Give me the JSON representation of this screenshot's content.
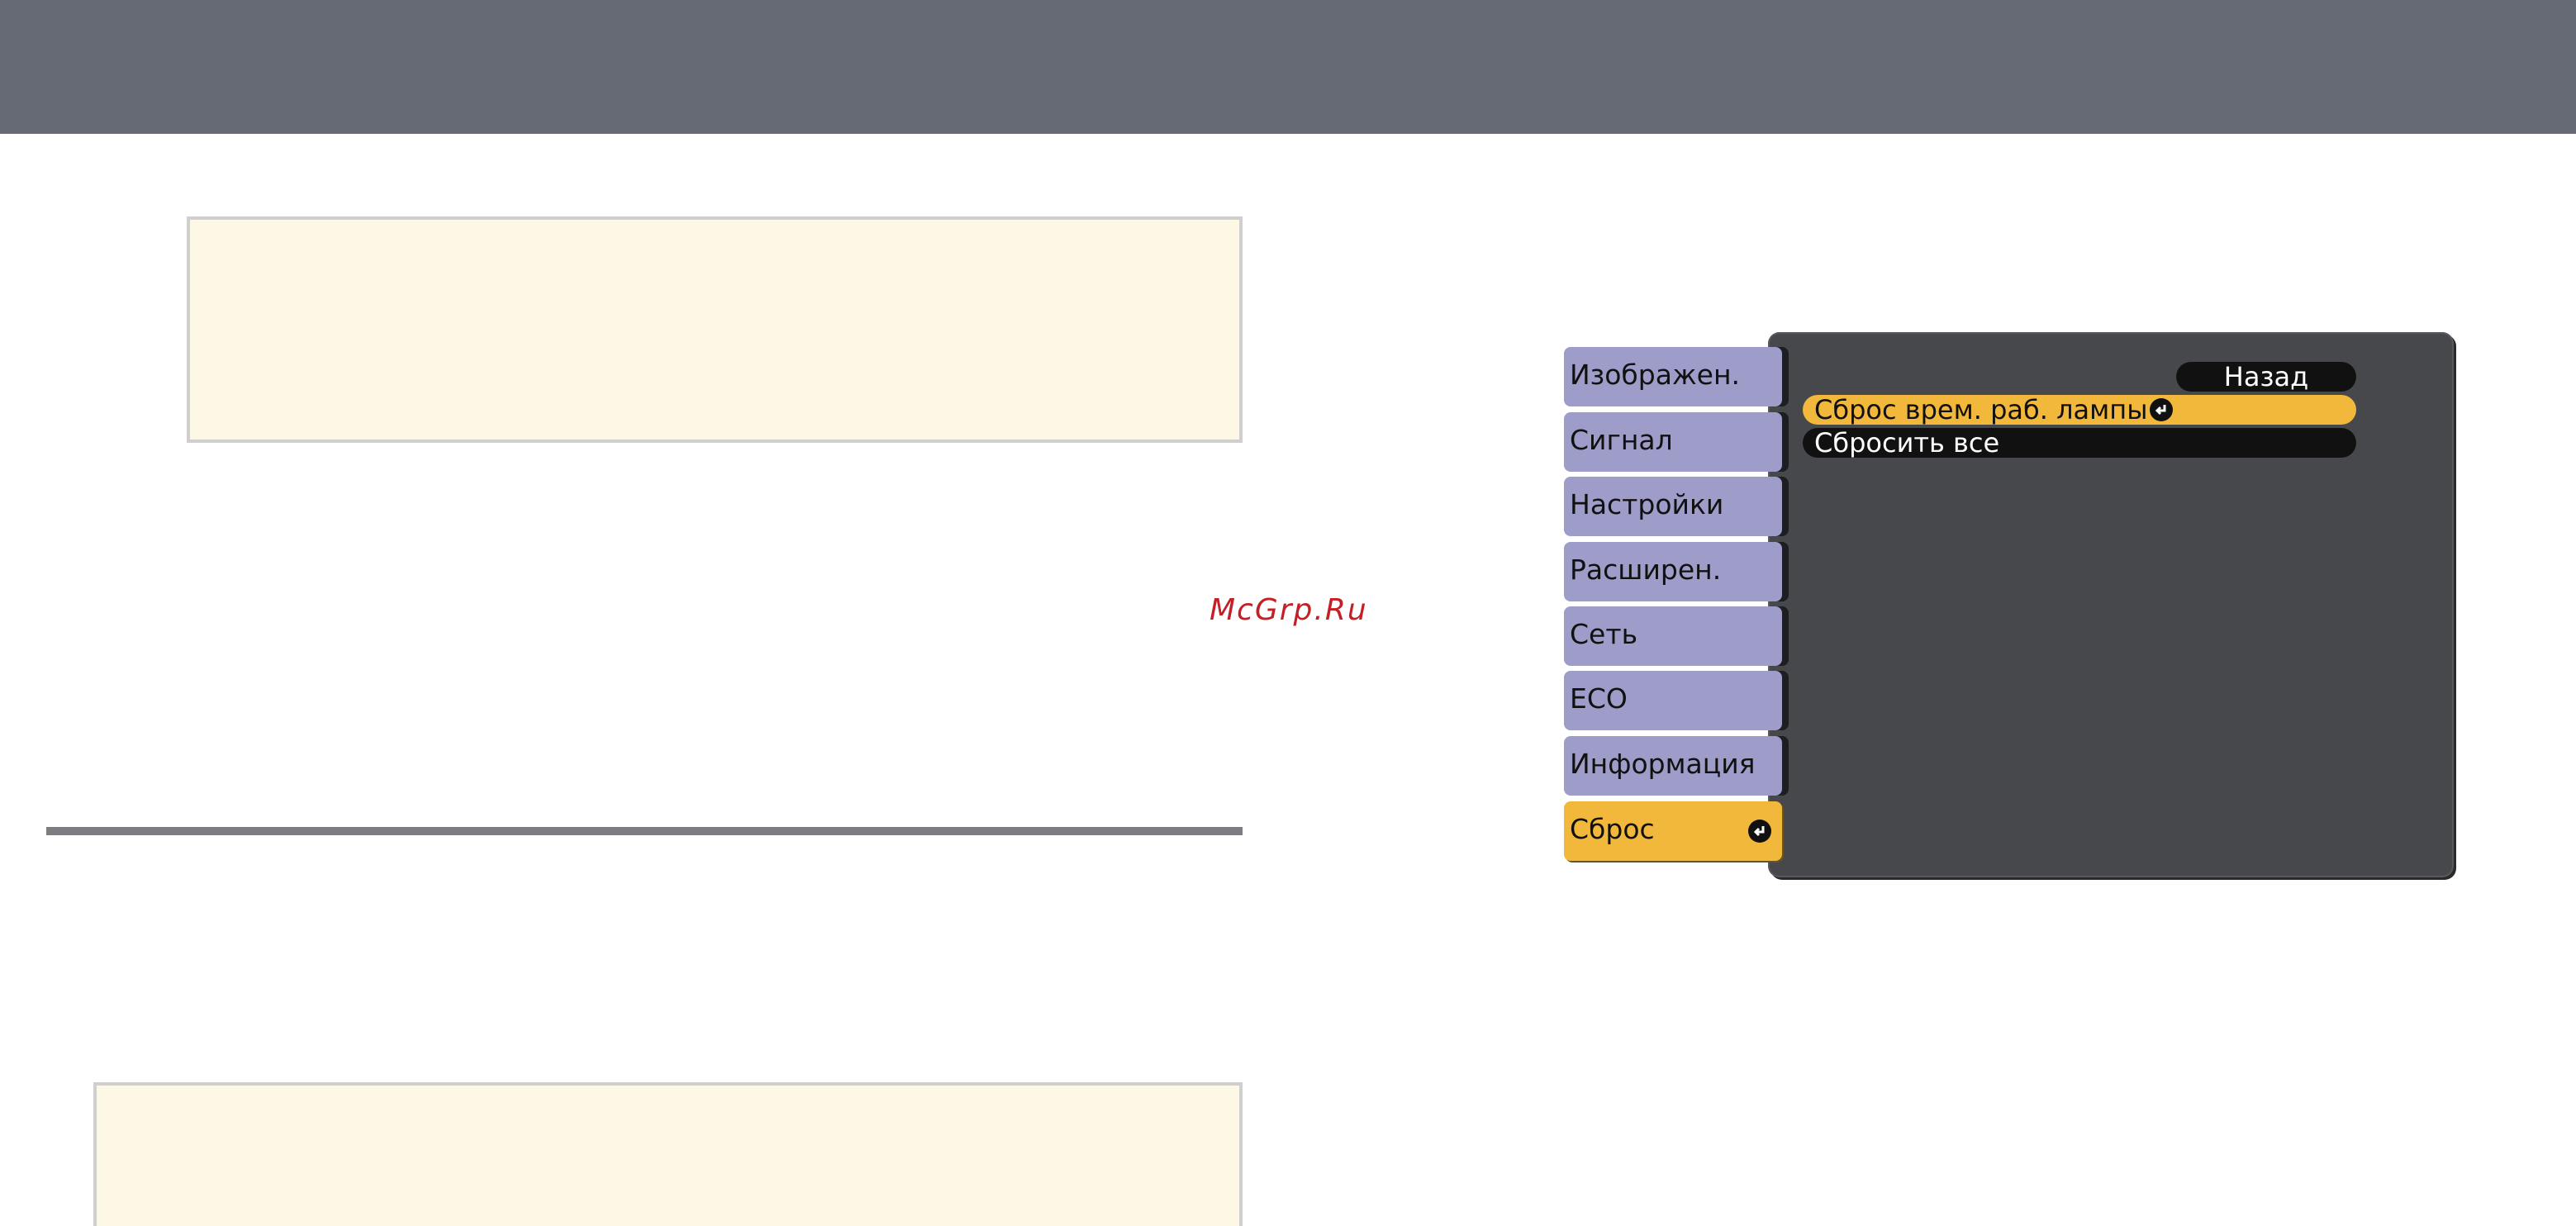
{
  "watermark": "McGrp.Ru",
  "menu": {
    "tabs": [
      {
        "label": "Изображен."
      },
      {
        "label": "Сигнал"
      },
      {
        "label": "Настройки"
      },
      {
        "label": "Расширен."
      },
      {
        "label": "Сеть"
      },
      {
        "label": "ECO"
      },
      {
        "label": "Информация"
      },
      {
        "label": "Сброс",
        "active": true
      }
    ],
    "back_label": "Назад",
    "items": [
      {
        "label": "Сброс врем. раб. лампы",
        "selected": true
      },
      {
        "label": "Сбросить все"
      }
    ]
  },
  "colors": {
    "header": "#666a74",
    "note_bg": "#fdf7e6",
    "tab_bg": "#9e9cc8",
    "highlight": "#f2b83c",
    "panel_bg": "#47484c"
  },
  "icons": [
    "enter-icon"
  ]
}
